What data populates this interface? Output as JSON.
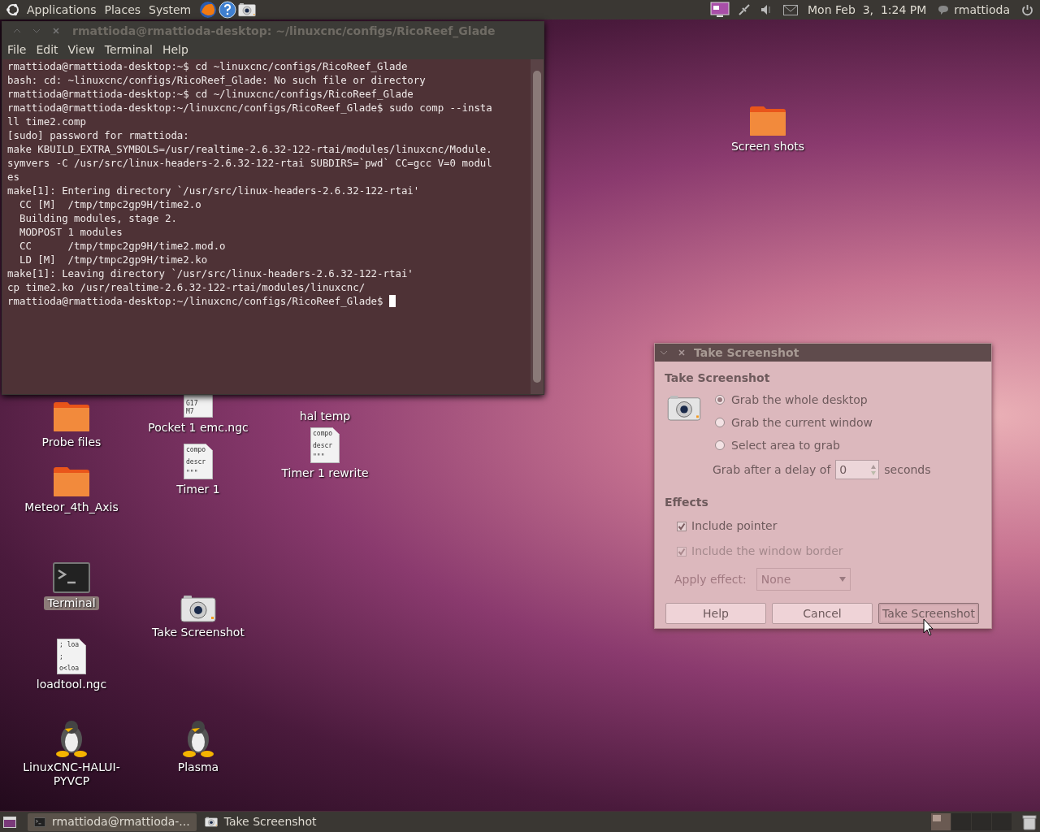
{
  "top_panel": {
    "menus": [
      {
        "label": "Applications"
      },
      {
        "label": "Places"
      },
      {
        "label": "System"
      }
    ],
    "clock": "Mon Feb  3,  1:24 PM",
    "user": "rmattioda"
  },
  "terminal": {
    "title": "rmattioda@rmattioda-desktop: ~/linuxcnc/configs/RicoReef_Glade",
    "menu": [
      {
        "label": "File"
      },
      {
        "label": "Edit"
      },
      {
        "label": "View"
      },
      {
        "label": "Terminal"
      },
      {
        "label": "Help"
      }
    ],
    "lines": [
      "rmattioda@rmattioda-desktop:~$ cd ~linuxcnc/configs/RicoReef_Glade",
      "bash: cd: ~linuxcnc/configs/RicoReef_Glade: No such file or directory",
      "rmattioda@rmattioda-desktop:~$ cd ~/linuxcnc/configs/RicoReef_Glade",
      "rmattioda@rmattioda-desktop:~/linuxcnc/configs/RicoReef_Glade$ sudo comp --insta",
      "ll time2.comp",
      "[sudo] password for rmattioda:",
      "make KBUILD_EXTRA_SYMBOLS=/usr/realtime-2.6.32-122-rtai/modules/linuxcnc/Module.",
      "symvers -C /usr/src/linux-headers-2.6.32-122-rtai SUBDIRS=`pwd` CC=gcc V=0 modul",
      "es",
      "make[1]: Entering directory `/usr/src/linux-headers-2.6.32-122-rtai'",
      "  CC [M]  /tmp/tmpc2gp9H/time2.o",
      "  Building modules, stage 2.",
      "  MODPOST 1 modules",
      "  CC      /tmp/tmpc2gp9H/time2.mod.o",
      "  LD [M]  /tmp/tmpc2gp9H/time2.ko",
      "make[1]: Leaving directory `/usr/src/linux-headers-2.6.32-122-rtai'",
      "cp time2.ko /usr/realtime-2.6.32-122-rtai/modules/linuxcnc/",
      "rmattioda@rmattioda-desktop:~/linuxcnc/configs/RicoReef_Glade$ "
    ]
  },
  "desktop_icons": [
    {
      "label": "Screen shots",
      "kind": "folder",
      "selected": false
    },
    {
      "label": "hal temp",
      "kind": "hidden",
      "selected": false
    },
    {
      "label": "Probe files",
      "kind": "folder",
      "selected": false
    },
    {
      "label": "Meteor_4th_Axis",
      "kind": "folder",
      "selected": false
    },
    {
      "label": "Terminal",
      "kind": "terminal",
      "selected": true
    },
    {
      "label": "loadtool.ngc",
      "kind": "file",
      "preview": [
        "; loa",
        ";",
        "o<loa"
      ],
      "selected": false
    },
    {
      "label": "LinuxCNC-HALUI-PYVCP",
      "kind": "penguin",
      "selected": false
    },
    {
      "label": "Pocket 1 emc.ngc",
      "kind": "file",
      "preview": [
        "G17",
        "M7"
      ],
      "selected": false
    },
    {
      "label": "Timer 1",
      "kind": "file",
      "preview": [
        "compo",
        "descr",
        "\"\"\""
      ],
      "selected": false
    },
    {
      "label": "Timer 1 rewrite",
      "kind": "file",
      "preview": [
        "compo",
        "descr",
        "\"\"\""
      ],
      "selected": false
    },
    {
      "label": "Take Screenshot",
      "kind": "camera",
      "selected": false
    },
    {
      "label": "Plasma",
      "kind": "penguin",
      "selected": false
    }
  ],
  "dialog": {
    "title": "Take Screenshot",
    "heading": "Take Screenshot",
    "options": [
      {
        "label": "Grab the whole desktop",
        "selected": true
      },
      {
        "label": "Grab the current window",
        "selected": false
      },
      {
        "label": "Select area to grab",
        "selected": false
      }
    ],
    "delay_label": "Grab after a delay of",
    "delay_value": "0",
    "delay_unit": "seconds",
    "effects_heading": "Effects",
    "checks": [
      {
        "label": "Include pointer",
        "checked": true,
        "disabled": false
      },
      {
        "label": "Include the window border",
        "checked": true,
        "disabled": true
      }
    ],
    "apply_effect": {
      "label": "Apply effect:",
      "value": "None",
      "disabled": true
    },
    "buttons": [
      {
        "label": "Help",
        "focused": false
      },
      {
        "label": "Cancel",
        "focused": false
      },
      {
        "label": "Take Screenshot",
        "focused": true
      }
    ]
  },
  "taskbar": {
    "tasks": [
      {
        "label": "rmattioda@rmattioda-...",
        "kind": "terminal",
        "selected": true
      },
      {
        "label": "Take Screenshot",
        "kind": "camera",
        "selected": false
      }
    ],
    "workspaces": [
      {
        "selected": true
      },
      {
        "selected": false
      },
      {
        "selected": false
      },
      {
        "selected": false
      }
    ]
  }
}
